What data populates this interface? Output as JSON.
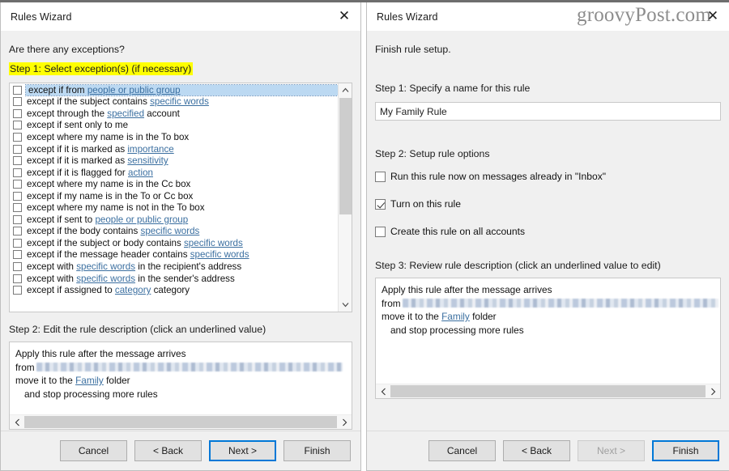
{
  "watermark": "groovyPost.com",
  "icons": {
    "close": "✕",
    "chevron_up": "⌃",
    "chevron_down": "⌄",
    "arrow_left": "‹",
    "arrow_right": "›"
  },
  "left_dialog": {
    "title": "Rules Wizard",
    "close_label": "✕",
    "lead": "Are there any exceptions?",
    "step1_label": "Step 1: Select exception(s) (if necessary)",
    "exceptions": [
      {
        "pre": "except if from ",
        "link": "people or public group",
        "post": "",
        "checked": false,
        "selected": true
      },
      {
        "pre": "except if the subject contains ",
        "link": "specific words",
        "post": "",
        "checked": false,
        "selected": false
      },
      {
        "pre": "except through the ",
        "link": "specified",
        "post": " account",
        "checked": false,
        "selected": false
      },
      {
        "pre": "except if sent only to me",
        "link": "",
        "post": "",
        "checked": false,
        "selected": false
      },
      {
        "pre": "except where my name is in the To box",
        "link": "",
        "post": "",
        "checked": false,
        "selected": false
      },
      {
        "pre": "except if it is marked as ",
        "link": "importance",
        "post": "",
        "checked": false,
        "selected": false
      },
      {
        "pre": "except if it is marked as ",
        "link": "sensitivity",
        "post": "",
        "checked": false,
        "selected": false
      },
      {
        "pre": "except if it is flagged for ",
        "link": "action",
        "post": "",
        "checked": false,
        "selected": false
      },
      {
        "pre": "except where my name is in the Cc box",
        "link": "",
        "post": "",
        "checked": false,
        "selected": false
      },
      {
        "pre": "except if my name is in the To or Cc box",
        "link": "",
        "post": "",
        "checked": false,
        "selected": false
      },
      {
        "pre": "except where my name is not in the To box",
        "link": "",
        "post": "",
        "checked": false,
        "selected": false
      },
      {
        "pre": "except if sent to ",
        "link": "people or public group",
        "post": "",
        "checked": false,
        "selected": false
      },
      {
        "pre": "except if the body contains ",
        "link": "specific words",
        "post": "",
        "checked": false,
        "selected": false
      },
      {
        "pre": "except if the subject or body contains ",
        "link": "specific words",
        "post": "",
        "checked": false,
        "selected": false
      },
      {
        "pre": "except if the message header contains ",
        "link": "specific words",
        "post": "",
        "checked": false,
        "selected": false
      },
      {
        "pre": "except with ",
        "link": "specific words",
        "post": " in the recipient's address",
        "checked": false,
        "selected": false
      },
      {
        "pre": "except with ",
        "link": "specific words",
        "post": " in the sender's address",
        "checked": false,
        "selected": false
      },
      {
        "pre": "except if assigned to ",
        "link": "category",
        "post": " category",
        "checked": false,
        "selected": false
      }
    ],
    "step2_label": "Step 2: Edit the rule description (click an underlined value)",
    "description": {
      "line1": "Apply this rule after the message arrives",
      "line2_pre": "from",
      "line2_redacted": true,
      "line3_pre": "move it to the ",
      "line3_link": "Family",
      "line3_post": " folder",
      "line4": "and stop processing more rules"
    },
    "buttons": {
      "cancel": "Cancel",
      "back": "< Back",
      "next": "Next >",
      "finish": "Finish"
    }
  },
  "right_dialog": {
    "title": "Rules Wizard",
    "close_label": "✕",
    "lead": "Finish rule setup.",
    "step1_label": "Step 1: Specify a name for this rule",
    "rule_name_value": "My Family Rule",
    "rule_name_placeholder": "",
    "step2_label": "Step 2: Setup rule options",
    "options": [
      {
        "label": "Run this rule now on messages already in \"Inbox\"",
        "checked": false
      },
      {
        "label": "Turn on this rule",
        "checked": true
      },
      {
        "label": "Create this rule on all accounts",
        "checked": false
      }
    ],
    "step3_label": "Step 3: Review rule description (click an underlined value to edit)",
    "description": {
      "line1": "Apply this rule after the message arrives",
      "line2_pre": "from",
      "line2_redacted": true,
      "line3_pre": "move it to the ",
      "line3_link": "Family",
      "line3_post": " folder",
      "line4": "and stop processing more rules"
    },
    "buttons": {
      "cancel": "Cancel",
      "back": "< Back",
      "next": "Next >",
      "next_disabled": true,
      "finish": "Finish"
    }
  },
  "colors": {
    "selection": "#bcd9f2",
    "link": "#3b6fa0",
    "highlight": "#ffff00",
    "default_button_border": "#0078d7",
    "dialog_bg": "#f0f0f0"
  }
}
